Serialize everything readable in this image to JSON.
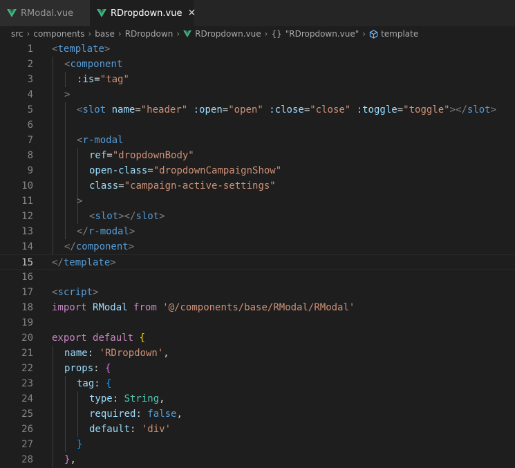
{
  "tabs": [
    {
      "label": "RModal.vue",
      "icon": "vue-icon",
      "active": false
    },
    {
      "label": "RDropdown.vue",
      "icon": "vue-icon",
      "active": true,
      "close": "✕"
    }
  ],
  "breadcrumb": {
    "items": [
      "src",
      "components",
      "base",
      "RDropdown",
      "RDropdown.vue",
      "\"RDropdown.vue\"",
      "template"
    ],
    "braces": "{}"
  },
  "colors": {
    "vue_green": "#41b883",
    "accent": "#75beff"
  },
  "editor": {
    "current_line": 15,
    "lines": [
      {
        "n": "1",
        "tokens": [
          [
            "<",
            "p"
          ],
          [
            "template",
            "tag"
          ],
          [
            ">",
            "p"
          ]
        ]
      },
      {
        "n": "2",
        "tokens": [
          [
            "<",
            "p"
          ],
          [
            "component",
            "tag"
          ]
        ]
      },
      {
        "n": "3",
        "tokens": [
          [
            ":is",
            "attr"
          ],
          [
            "=",
            "plain"
          ],
          [
            "\"tag\"",
            "str"
          ]
        ]
      },
      {
        "n": "4",
        "tokens": [
          [
            ">",
            "p"
          ]
        ]
      },
      {
        "n": "5",
        "tokens": [
          [
            "<",
            "p"
          ],
          [
            "slot",
            "tag"
          ],
          [
            " ",
            "plain"
          ],
          [
            "name",
            "attr"
          ],
          [
            "=",
            "plain"
          ],
          [
            "\"header\"",
            "str"
          ],
          [
            " ",
            "plain"
          ],
          [
            ":open",
            "attr"
          ],
          [
            "=",
            "plain"
          ],
          [
            "\"open\"",
            "str"
          ],
          [
            " ",
            "plain"
          ],
          [
            ":close",
            "attr"
          ],
          [
            "=",
            "plain"
          ],
          [
            "\"close\"",
            "str"
          ],
          [
            " ",
            "plain"
          ],
          [
            ":toggle",
            "attr"
          ],
          [
            "=",
            "plain"
          ],
          [
            "\"toggle\"",
            "str"
          ],
          [
            "></",
            "p"
          ],
          [
            "slot",
            "tag"
          ],
          [
            ">",
            "p"
          ]
        ]
      },
      {
        "n": "6",
        "tokens": []
      },
      {
        "n": "7",
        "tokens": [
          [
            "<",
            "p"
          ],
          [
            "r-modal",
            "tag"
          ]
        ]
      },
      {
        "n": "8",
        "tokens": [
          [
            "ref",
            "attr"
          ],
          [
            "=",
            "plain"
          ],
          [
            "\"dropdownBody\"",
            "str"
          ]
        ]
      },
      {
        "n": "9",
        "tokens": [
          [
            "open-class",
            "attr"
          ],
          [
            "=",
            "plain"
          ],
          [
            "\"dropdownCampaignShow\"",
            "str"
          ]
        ]
      },
      {
        "n": "10",
        "tokens": [
          [
            "class",
            "attr"
          ],
          [
            "=",
            "plain"
          ],
          [
            "\"campaign-active-settings\"",
            "str"
          ]
        ]
      },
      {
        "n": "11",
        "tokens": [
          [
            ">",
            "p"
          ]
        ]
      },
      {
        "n": "12",
        "tokens": [
          [
            "<",
            "p"
          ],
          [
            "slot",
            "tag"
          ],
          [
            "></",
            "p"
          ],
          [
            "slot",
            "tag"
          ],
          [
            ">",
            "p"
          ]
        ]
      },
      {
        "n": "13",
        "tokens": [
          [
            "</",
            "p"
          ],
          [
            "r-modal",
            "tag"
          ],
          [
            ">",
            "p"
          ]
        ]
      },
      {
        "n": "14",
        "tokens": [
          [
            "</",
            "p"
          ],
          [
            "component",
            "tag"
          ],
          [
            ">",
            "p"
          ]
        ]
      },
      {
        "n": "15",
        "tokens": [
          [
            "</",
            "p"
          ],
          [
            "template",
            "tag"
          ],
          [
            ">",
            "p"
          ]
        ]
      },
      {
        "n": "16",
        "tokens": []
      },
      {
        "n": "17",
        "tokens": [
          [
            "<",
            "p"
          ],
          [
            "script",
            "tag"
          ],
          [
            ">",
            "p"
          ]
        ]
      },
      {
        "n": "18",
        "tokens": [
          [
            "import",
            "kw"
          ],
          [
            " ",
            "plain"
          ],
          [
            "RModal",
            "var"
          ],
          [
            " ",
            "plain"
          ],
          [
            "from",
            "kw"
          ],
          [
            " ",
            "plain"
          ],
          [
            "'@/components/base/RModal/RModal'",
            "str"
          ]
        ]
      },
      {
        "n": "19",
        "tokens": []
      },
      {
        "n": "20",
        "tokens": [
          [
            "export",
            "kw"
          ],
          [
            " ",
            "plain"
          ],
          [
            "default",
            "kw"
          ],
          [
            " ",
            "plain"
          ],
          [
            "{",
            "b1"
          ]
        ]
      },
      {
        "n": "21",
        "tokens": [
          [
            "name",
            "var"
          ],
          [
            ": ",
            "plain"
          ],
          [
            "'RDropdown'",
            "str"
          ],
          [
            ",",
            "plain"
          ]
        ]
      },
      {
        "n": "22",
        "tokens": [
          [
            "props",
            "var"
          ],
          [
            ": ",
            "plain"
          ],
          [
            "{",
            "b2"
          ]
        ]
      },
      {
        "n": "23",
        "tokens": [
          [
            "tag",
            "var"
          ],
          [
            ": ",
            "plain"
          ],
          [
            "{",
            "b3"
          ]
        ]
      },
      {
        "n": "24",
        "tokens": [
          [
            "type",
            "var"
          ],
          [
            ": ",
            "plain"
          ],
          [
            "String",
            "type"
          ],
          [
            ",",
            "plain"
          ]
        ]
      },
      {
        "n": "25",
        "tokens": [
          [
            "required",
            "var"
          ],
          [
            ": ",
            "plain"
          ],
          [
            "false",
            "bool"
          ],
          [
            ",",
            "plain"
          ]
        ]
      },
      {
        "n": "26",
        "tokens": [
          [
            "default",
            "var"
          ],
          [
            ": ",
            "plain"
          ],
          [
            "'div'",
            "str"
          ]
        ]
      },
      {
        "n": "27",
        "tokens": [
          [
            "}",
            "b3"
          ]
        ]
      },
      {
        "n": "28",
        "tokens": [
          [
            "}",
            "b2"
          ],
          [
            ",",
            "plain"
          ]
        ]
      }
    ]
  }
}
